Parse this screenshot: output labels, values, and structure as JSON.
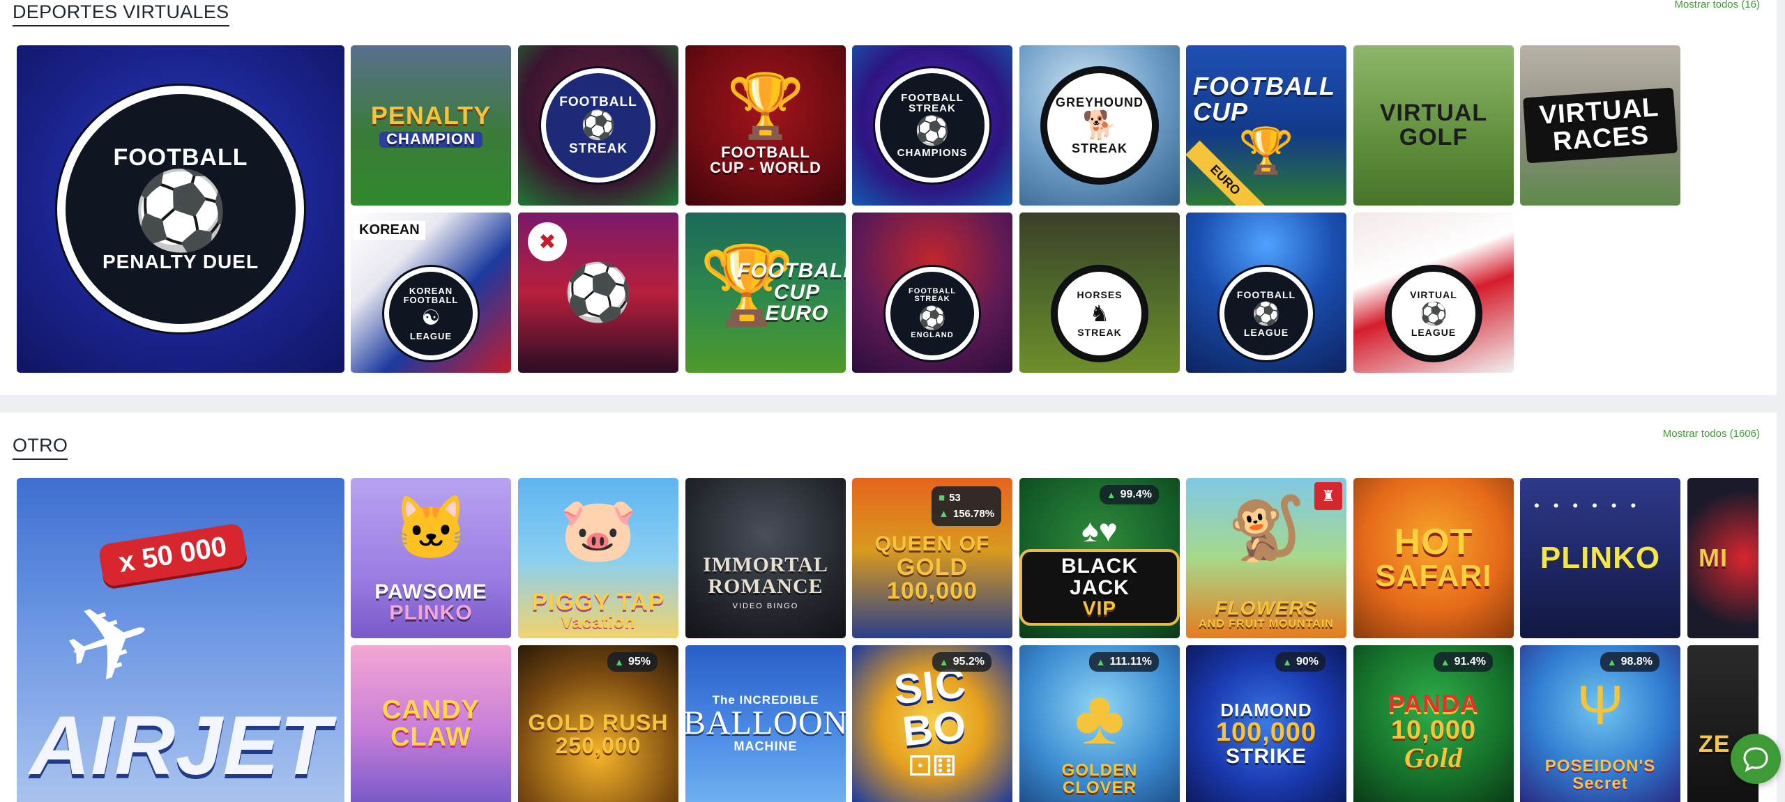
{
  "sections": [
    {
      "title": "DEPORTES VIRTUALES",
      "show_all": "Mostrar todos (16)",
      "games": [
        {
          "title": "FOOTBALL",
          "title2": "PENALTY DUEL"
        },
        {
          "title": "PENALTY",
          "title2": "CHAMPION"
        },
        {
          "title": "FOOTBALL",
          "title2": "STREAK"
        },
        {
          "title": "FOOTBALL",
          "title2": "CUP - WORLD"
        },
        {
          "title": "FOOTBALL STREAK",
          "title2": "CHAMPIONS"
        },
        {
          "title": "GREYHOUND",
          "title2": "STREAK"
        },
        {
          "title": "FOOTBALL",
          "title2": "CUP",
          "tag": "EURO"
        },
        {
          "title": "VIRTUAL",
          "title2": "GOLF"
        },
        {
          "title": "VIRTUAL",
          "title2": "RACES"
        },
        {
          "title": "KOREAN",
          "title2": "LEAGUE",
          "tag": "KOREAN",
          "crest_top": "KOREAN FOOTBALL"
        },
        {
          "title": "",
          "title2": ""
        },
        {
          "title": "FOOTBALL",
          "title2": "CUP EURO"
        },
        {
          "title": "FOOTBALL STREAK",
          "title2": "ENGLAND"
        },
        {
          "title": "HORSES",
          "title2": "STREAK"
        },
        {
          "title": "FOOTBALL",
          "title2": "LEAGUE"
        },
        {
          "title": "VIRTUAL",
          "title2": "LEAGUE"
        }
      ]
    },
    {
      "title": "OTRO",
      "show_all": "Mostrar todos (1606)",
      "games": [
        {
          "title": "AIRJET",
          "multiplier": "x 50 000"
        },
        {
          "title": "PAWSOME",
          "title2": "PLINKO"
        },
        {
          "title": "PIGGY TAP",
          "title2": "Vacation"
        },
        {
          "title": "IMMORTAL",
          "title2": "ROMANCE",
          "subtitle": "VIDEO BINGO"
        },
        {
          "title": "QUEEN OF",
          "title2": "GOLD",
          "title3": "100,000",
          "players": "53",
          "rtp": "156.78%"
        },
        {
          "title": "BLACK JACK",
          "title2": "VIP",
          "rtp": "99.4%"
        },
        {
          "title": "FLOWERS",
          "title2": "AND FRUIT MOUNTAIN"
        },
        {
          "title": "HOT",
          "title2": "SAFARI"
        },
        {
          "title": "PLINKO",
          "title2": ""
        },
        {
          "title": "MI",
          "title2": ""
        },
        {
          "title": "CANDY",
          "title2": "CLAW"
        },
        {
          "title": "GOLD RUSH",
          "title2": "250,000",
          "rtp": "95%"
        },
        {
          "title": "The INCREDIBLE",
          "title2": "BALLOON",
          "title3": "MACHINE"
        },
        {
          "title": "SIC BO",
          "title2": "",
          "rtp": "95.2%"
        },
        {
          "title": "GOLDEN CLOVER",
          "title2": "",
          "rtp": "111.11%"
        },
        {
          "title": "DIAMOND",
          "title2": "100,000",
          "title3": "STRIKE",
          "rtp": "90%"
        },
        {
          "title": "PANDA",
          "title2": "10,000",
          "title3": "Gold",
          "rtp": "91.4%"
        },
        {
          "title": "POSEIDON'S",
          "title2": "Secret",
          "rtp": "98.8%"
        },
        {
          "title": "ZE",
          "title2": ""
        }
      ]
    }
  ],
  "colors": {
    "accent": "#3d9a35",
    "heading": "#1e2732",
    "page_bg": "#eef0f3"
  },
  "icons": {
    "chat": "chat-bubble-icon",
    "rtp": "rtp-arrow-icon",
    "players": "players-icon"
  }
}
